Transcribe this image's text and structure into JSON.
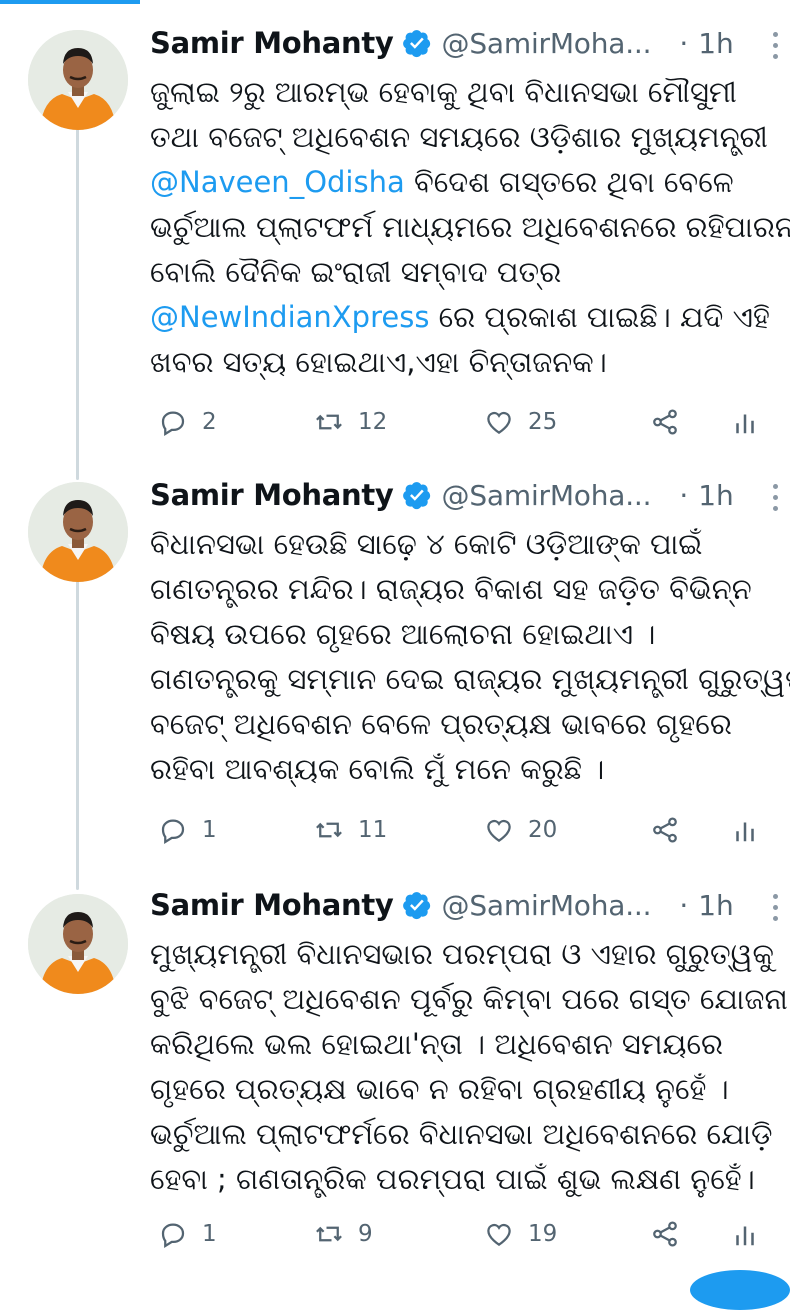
{
  "tweets": [
    {
      "name": "Samir Mohanty",
      "handle": "@SamirMoha...",
      "separator": "·",
      "time": "1h",
      "lines": [
        [
          {
            "t": "ଜୁଲାଇ ୨ରୁ ଆରମ୍ଭ ହେବାକୁ ଥିବା ବିଧାନସଭା ମୌସୁମୀ"
          }
        ],
        [
          {
            "t": "ତଥା ବଜେଟ୍ ଅଧିବେଶନ ସମୟରେ ଓଡ଼ିଶାର ମୁଖ୍ୟମନ୍ତ୍ରୀ"
          }
        ],
        [
          {
            "t": "@Naveen_Odisha",
            "link": true
          },
          {
            "t": " ବିଦେଶ ଗସ୍ତରେ ଥିବା ବେଳେ"
          }
        ],
        [
          {
            "t": "ଭର୍ଚୁଆଲ ପ୍ଲାଟଫର୍ମ ମାଧ୍ୟମରେ ଅଧିବେଶନରେ ରହିପାରନ୍ତି"
          }
        ],
        [
          {
            "t": "ବୋଲି ଦୈନିକ ଇଂରାଜୀ ସମ୍ବାଦ ପତ୍ର"
          }
        ],
        [
          {
            "t": "@NewIndianXpress",
            "link": true
          },
          {
            "t": " ରେ ପ୍ରକାଶ ପାଇଛି। ଯଦି ଏହି"
          }
        ],
        [
          {
            "t": "ଖବର ସତ୍ୟ ହୋଇଥାଏ,ଏହା ଚିନ୍ତାଜନକ।"
          }
        ]
      ],
      "replies": "2",
      "retweets": "12",
      "likes": "25"
    },
    {
      "name": "Samir Mohanty",
      "handle": "@SamirMoha...",
      "separator": "·",
      "time": "1h",
      "lines": [
        [
          {
            "t": "ବିଧାନସଭା ହେଉଛି ସାଢ଼େ ୪ କୋଟି ଓଡ଼ିଆଙ୍କ ପାଇଁ"
          }
        ],
        [
          {
            "t": "ଗଣତନ୍ତ୍ରର ମନ୍ଦିର। ରାଜ୍ୟର ବିକାଶ ସହ ଜଡ଼ିତ ବିଭିନ୍ନ"
          }
        ],
        [
          {
            "t": "ବିଷୟ ଉପରେ ଗୃହରେ ଆଲୋଚନା ହୋଇଥାଏ ।"
          }
        ],
        [
          {
            "t": "ଗଣତନ୍ତ୍ରକୁ ସମ୍ମାନ ଦେଇ ରାଜ୍ୟର ମୁଖ୍ୟମନ୍ତ୍ରୀ ଗୁରୁତ୍ୱପୂର୍ଣ୍ଣ"
          }
        ],
        [
          {
            "t": "ବଜେଟ୍ ଅଧିବେଶନ ବେଳେ ପ୍ରତ୍ୟକ୍ଷ ଭାବରେ ଗୃହରେ"
          }
        ],
        [
          {
            "t": "ରହିବା ଆବଶ୍ୟକ ବୋଲି ମୁଁ ମନେ କରୁଛି ।"
          }
        ]
      ],
      "replies": "1",
      "retweets": "11",
      "likes": "20"
    },
    {
      "name": "Samir Mohanty",
      "handle": "@SamirMoha...",
      "separator": "·",
      "time": "1h",
      "lines": [
        [
          {
            "t": "ମୁଖ୍ୟମନ୍ତ୍ରୀ ବିଧାନସଭାର ପରମ୍ପରା ଓ ଏହାର ଗୁରୁତ୍ୱକୁ"
          }
        ],
        [
          {
            "t": "ବୁଝି ବଜେଟ୍ ଅଧିବେଶନ ପୂର୍ବରୁ କିମ୍ବା ପରେ ଗସ୍ତ ଯୋଜନା"
          }
        ],
        [
          {
            "t": "କରିଥିଲେ ଭଲ ହୋଇଥା'ନ୍ତା । ଅଧିବେଶନ ସମୟରେ"
          }
        ],
        [
          {
            "t": "ଗୃହରେ ପ୍ରତ୍ୟକ୍ଷ ଭାବେ ନ ରହିବା ଗ୍ରହଣୀୟ ନୁହେଁ ।"
          }
        ],
        [
          {
            "t": "ଭର୍ଚୁଆଲ ପ୍ଲାଟଫର୍ମରେ ବିଧାନସଭା ଅଧିବେଶନରେ ଯୋଡ଼ି"
          }
        ],
        [
          {
            "t": "ହେବା ; ଗଣତାନ୍ତ୍ରିକ ପରମ୍ପରା ପାଇଁ ଶୁଭ ଲକ୍ଷଣ ନୁହେଁ।"
          }
        ]
      ],
      "replies": "1",
      "retweets": "9",
      "likes": "19"
    }
  ],
  "icons": {
    "verified": "verified-badge-icon",
    "reply": "reply-icon",
    "retweet": "retweet-icon",
    "like": "heart-icon",
    "share": "share-icon",
    "stats": "analytics-icon",
    "more": "more-options-icon"
  },
  "colors": {
    "accent": "#1d9bf0",
    "text": "#0f1419",
    "secondary": "#536471",
    "thread_line": "#cfd9de",
    "background": "#ffffff"
  }
}
